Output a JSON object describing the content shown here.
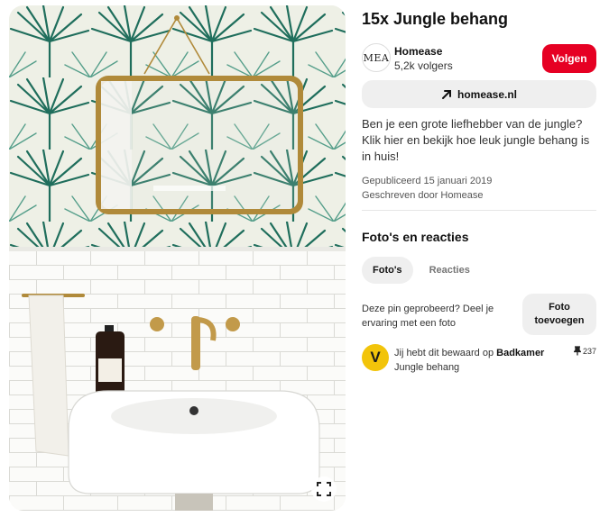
{
  "pin": {
    "title": "15x Jungle behang",
    "image_alt": "Badkamer met jungle behang, gouden spiegel en witte wastafel"
  },
  "creator": {
    "avatar_text": "MEA",
    "name": "Homease",
    "followers": "5,2k volgers",
    "follow_label": "Volgen"
  },
  "link": {
    "label": "homease.nl",
    "icon": "arrow-up-right-icon"
  },
  "description": "Ben je een grote liefhebber van de jungle? Klik hier en bekijk hoe leuk jungle behang is in huis!",
  "meta": {
    "published": "Gepubliceerd 15 januari 2019",
    "written_by": "Geschreven door Homease"
  },
  "reactions": {
    "section_title": "Foto's en reacties",
    "tabs": [
      {
        "label": "Foto's",
        "active": true
      },
      {
        "label": "Reacties",
        "active": false
      }
    ],
    "try_prompt": "Deze pin geprobeerd? Deel je ervaring met een foto",
    "add_photo_label": "Foto toevoegen"
  },
  "saved": {
    "avatar_letter": "V",
    "prefix": "Jij hebt dit bewaard op",
    "board": "Badkamer",
    "board_line2": "Jungle behang",
    "pin_count": "237",
    "pin_icon": "pushpin-icon"
  },
  "colors": {
    "accent": "#e60023",
    "button_grey": "#efefef",
    "saved_avatar": "#f2c40a",
    "wallpaper_green": "#1f6e5c",
    "brass": "#b08a3a"
  }
}
